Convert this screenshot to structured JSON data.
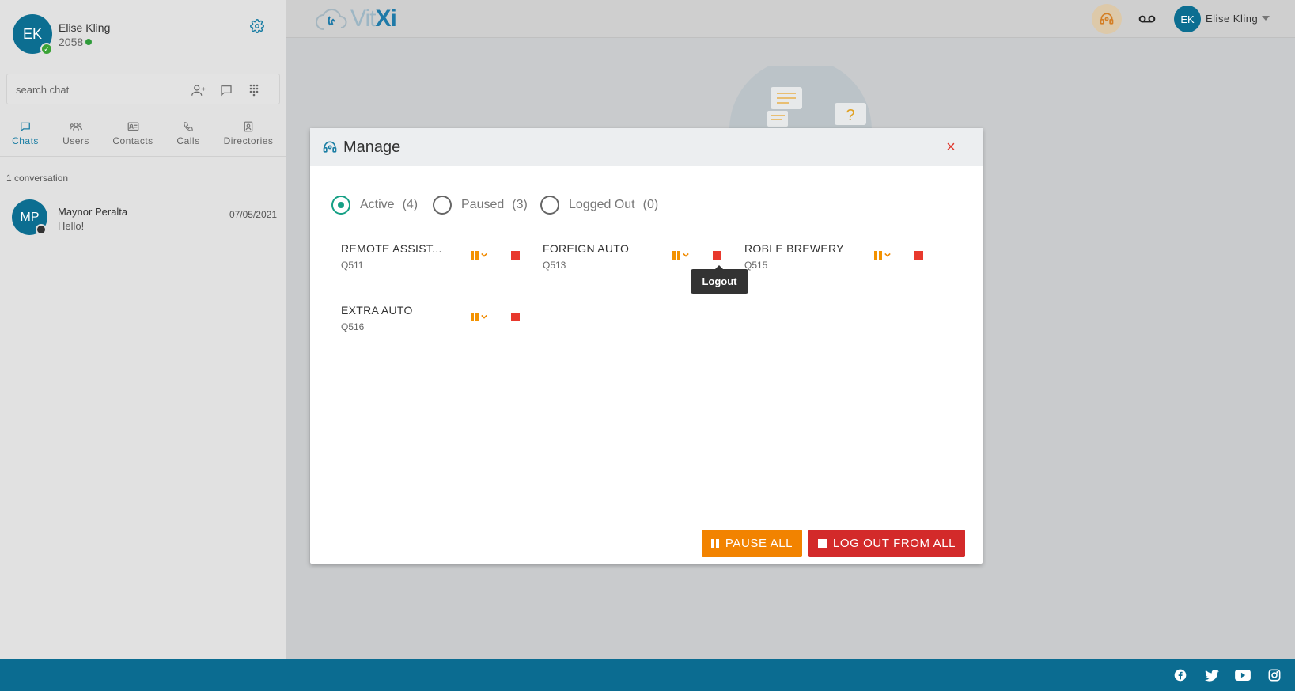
{
  "profile": {
    "initials": "EK",
    "name": "Elise Kling",
    "extension": "2058"
  },
  "search": {
    "placeholder": "search chat"
  },
  "tabs": [
    {
      "label": "Chats",
      "icon": "chat-icon",
      "active": true
    },
    {
      "label": "Users",
      "icon": "users-icon"
    },
    {
      "label": "Contacts",
      "icon": "contact-card-icon"
    },
    {
      "label": "Calls",
      "icon": "phone-icon"
    },
    {
      "label": "Directories",
      "icon": "directory-icon"
    }
  ],
  "conversations": {
    "count_label": "1 conversation",
    "items": [
      {
        "initials": "MP",
        "name": "Maynor Peralta",
        "message": "Hello!",
        "date": "07/05/2021"
      }
    ]
  },
  "topbar": {
    "logo_light": "Vit",
    "logo_bold": "Xi",
    "user_initials": "EK",
    "user_name": "Elise Kling"
  },
  "modal": {
    "title": "Manage",
    "close": "×",
    "filters": [
      {
        "label": "Active",
        "count": "(4)",
        "selected": true
      },
      {
        "label": "Paused",
        "count": "(3)",
        "selected": false
      },
      {
        "label": "Logged Out",
        "count": "(0)",
        "selected": false
      }
    ],
    "queues": [
      {
        "name": "REMOTE ASSIST...",
        "id": "Q511"
      },
      {
        "name": "FOREIGN AUTO",
        "id": "Q513"
      },
      {
        "name": "ROBLE BREWERY",
        "id": "Q515"
      },
      {
        "name": "EXTRA AUTO",
        "id": "Q516"
      }
    ],
    "tooltip": "Logout",
    "pause_all": "PAUSE ALL",
    "logout_all": "LOG OUT FROM ALL"
  },
  "colors": {
    "brand": "#0b6c91",
    "accent": "#1b7ea4",
    "pause": "#f28300",
    "stop": "#d32a2a",
    "active_radio": "#16a085"
  },
  "footer": {
    "social": [
      "facebook-icon",
      "twitter-icon",
      "youtube-icon",
      "instagram-icon"
    ]
  }
}
